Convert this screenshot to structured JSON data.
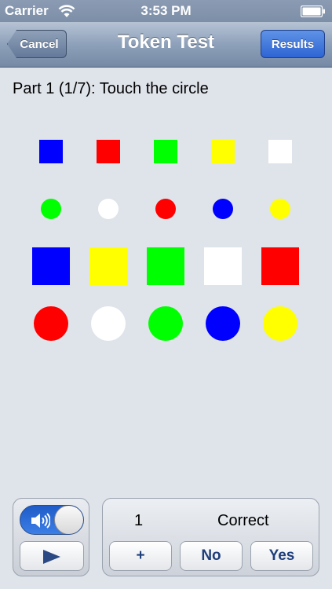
{
  "status_bar": {
    "carrier": "Carrier",
    "time": "3:53 PM",
    "wifi_icon": "wifi-icon",
    "battery_icon": "battery-icon"
  },
  "nav": {
    "title": "Token Test",
    "cancel_label": "Cancel",
    "results_label": "Results"
  },
  "instruction": "Part 1 (1/7): Touch the circle",
  "colors": {
    "blue": "#0000ff",
    "red": "#ff0000",
    "green": "#00ff00",
    "yellow": "#ffff00",
    "white": "#ffffff"
  },
  "tokens": [
    {
      "shape": "square",
      "size": "small",
      "color": "blue"
    },
    {
      "shape": "square",
      "size": "small",
      "color": "red"
    },
    {
      "shape": "square",
      "size": "small",
      "color": "green"
    },
    {
      "shape": "square",
      "size": "small",
      "color": "yellow"
    },
    {
      "shape": "square",
      "size": "small",
      "color": "white"
    },
    {
      "shape": "circle",
      "size": "small",
      "color": "green"
    },
    {
      "shape": "circle",
      "size": "small",
      "color": "white"
    },
    {
      "shape": "circle",
      "size": "small",
      "color": "red"
    },
    {
      "shape": "circle",
      "size": "small",
      "color": "blue"
    },
    {
      "shape": "circle",
      "size": "small",
      "color": "yellow"
    },
    {
      "shape": "square",
      "size": "large",
      "color": "blue"
    },
    {
      "shape": "square",
      "size": "large",
      "color": "yellow"
    },
    {
      "shape": "square",
      "size": "large",
      "color": "green"
    },
    {
      "shape": "square",
      "size": "large",
      "color": "white"
    },
    {
      "shape": "square",
      "size": "large",
      "color": "red"
    },
    {
      "shape": "circle",
      "size": "large",
      "color": "red"
    },
    {
      "shape": "circle",
      "size": "large",
      "color": "white"
    },
    {
      "shape": "circle",
      "size": "large",
      "color": "green"
    },
    {
      "shape": "circle",
      "size": "large",
      "color": "blue"
    },
    {
      "shape": "circle",
      "size": "large",
      "color": "yellow"
    }
  ],
  "controls": {
    "sound_on": true,
    "speaker_icon": "speaker-icon",
    "play_icon": "play-icon",
    "count": "1",
    "status": "Correct",
    "plus_label": "+",
    "no_label": "No",
    "yes_label": "Yes"
  }
}
